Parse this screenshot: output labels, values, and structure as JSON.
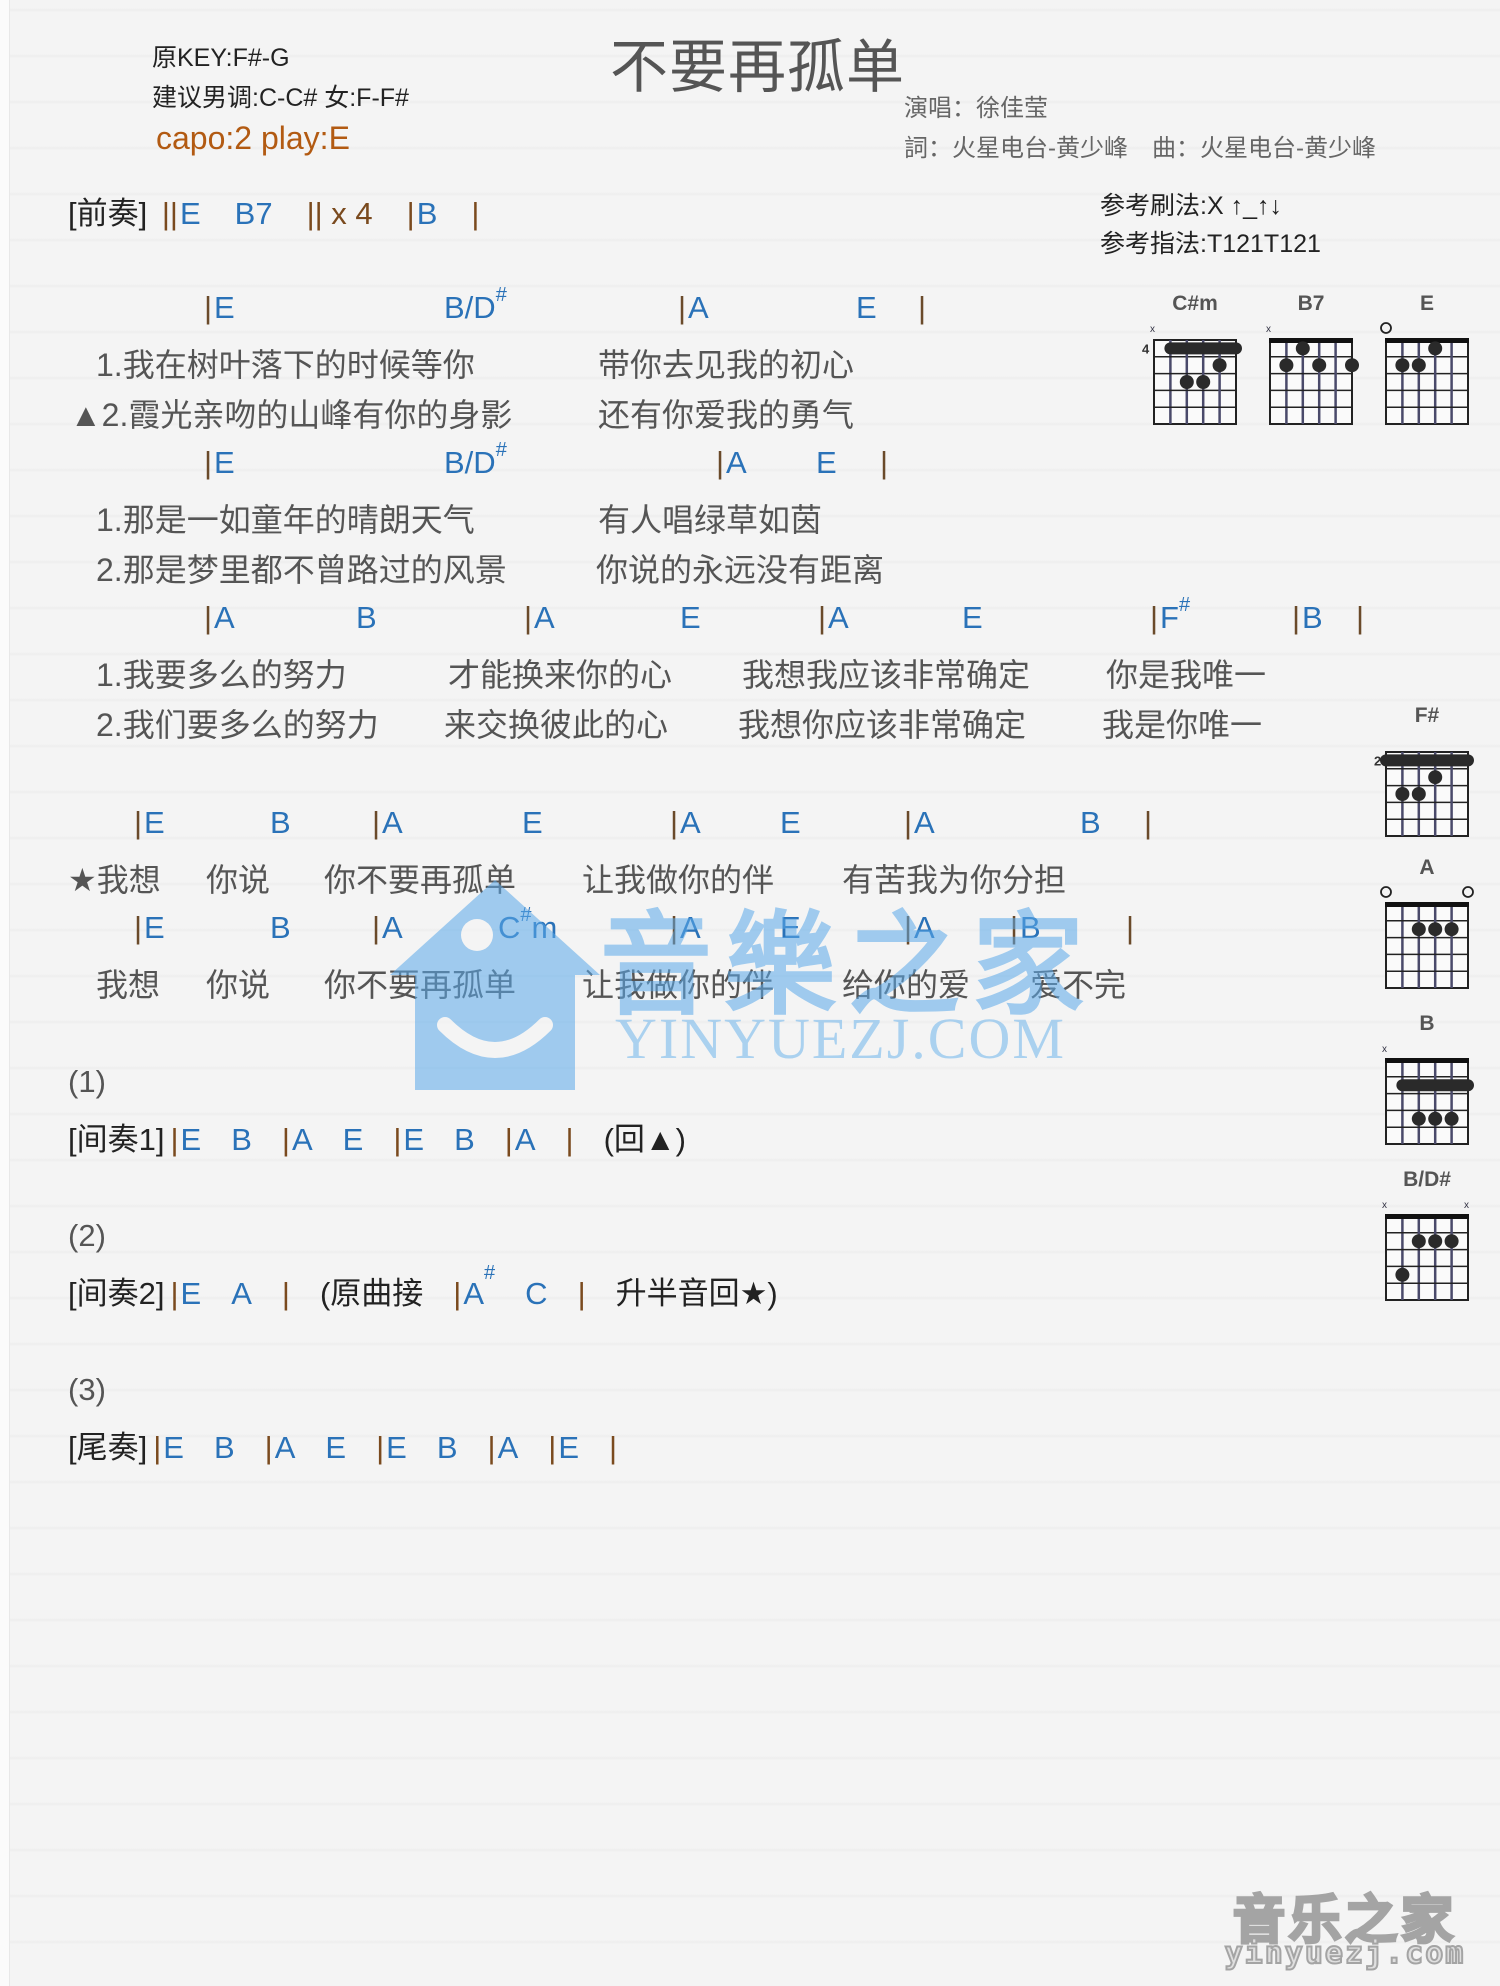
{
  "header": {
    "original_key": "原KEY:F#-G",
    "suggested_key": "建议男调:C-C# 女:F-F#",
    "capo": "capo:2 play:E",
    "title": "不要再孤单",
    "singer": "演唱：徐佳莹",
    "credits": "詞：火星电台-黄少峰　曲：火星电台-黄少峰",
    "strum_pattern": "参考刷法:X ↑_↑↓",
    "finger_pattern": "参考指法:T121T121"
  },
  "prelude": {
    "label": "[前奏]",
    "tokens": [
      {
        "t": "||",
        "k": "bar"
      },
      {
        "t": "E",
        "k": "chord"
      },
      {
        "t": "B7",
        "k": "chord"
      },
      {
        "t": "|| x 4",
        "k": "bar"
      },
      {
        "t": "|",
        "k": "bar"
      },
      {
        "t": "B",
        "k": "chord"
      },
      {
        "t": "|",
        "k": "bar"
      }
    ]
  },
  "verse_blocks": [
    {
      "chords": [
        {
          "bar": true,
          "name": "E"
        },
        {
          "bar": false,
          "name": "B/D",
          "sup": "#"
        },
        {
          "bar": true,
          "name": "A"
        },
        {
          "bar": false,
          "name": "E"
        },
        {
          "bar": true,
          "name": ""
        }
      ],
      "lyrics": [
        [
          "1.我在树叶落下的时候等你",
          "带你去见我的初心"
        ],
        [
          "▲2.霞光亲吻的山峰有你的身影",
          "还有你爱我的勇气"
        ]
      ]
    },
    {
      "chords": [
        {
          "bar": true,
          "name": "E"
        },
        {
          "bar": false,
          "name": "B/D",
          "sup": "#"
        },
        {
          "bar": true,
          "name": "A"
        },
        {
          "bar": false,
          "name": "E"
        },
        {
          "bar": true,
          "name": ""
        }
      ],
      "lyrics": [
        [
          "1.那是一如童年的晴朗天气",
          "有人唱绿草如茵"
        ],
        [
          "2.那是梦里都不曾路过的风景",
          "你说的永远没有距离"
        ]
      ]
    },
    {
      "chords": [
        {
          "bar": true,
          "name": "A"
        },
        {
          "bar": false,
          "name": "B"
        },
        {
          "bar": true,
          "name": "A"
        },
        {
          "bar": false,
          "name": "E"
        },
        {
          "bar": true,
          "name": "A"
        },
        {
          "bar": false,
          "name": "E"
        },
        {
          "bar": true,
          "name": "F",
          "sup": "#"
        },
        {
          "bar": true,
          "name": "B"
        },
        {
          "bar": true,
          "name": ""
        }
      ],
      "lyrics": [
        [
          "1.我要多么的努力",
          "才能换来你的心",
          "我想我应该非常确定",
          "你是我唯一"
        ],
        [
          "2.我们要多么的努力",
          "来交换彼此的心",
          "我想你应该非常确定",
          "我是你唯一"
        ]
      ]
    },
    {
      "chords": [
        {
          "bar": true,
          "name": "E"
        },
        {
          "bar": false,
          "name": "B"
        },
        {
          "bar": true,
          "name": "A"
        },
        {
          "bar": false,
          "name": "E"
        },
        {
          "bar": true,
          "name": "A"
        },
        {
          "bar": false,
          "name": "E"
        },
        {
          "bar": true,
          "name": "A"
        },
        {
          "bar": false,
          "name": "B"
        },
        {
          "bar": true,
          "name": ""
        }
      ],
      "lyrics": [
        [
          "★我想",
          "你说",
          "你不要再孤单",
          "让我做你的伴",
          "有苦我为你分担"
        ]
      ]
    },
    {
      "chords": [
        {
          "bar": true,
          "name": "E"
        },
        {
          "bar": false,
          "name": "B"
        },
        {
          "bar": true,
          "name": "A"
        },
        {
          "bar": false,
          "name": "C",
          "sup": "#",
          "suffix": "m"
        },
        {
          "bar": true,
          "name": "A"
        },
        {
          "bar": false,
          "name": "E"
        },
        {
          "bar": true,
          "name": "A"
        },
        {
          "bar": true,
          "name": "B"
        },
        {
          "bar": true,
          "name": ""
        }
      ],
      "lyrics": [
        [
          "我想",
          "你说",
          "你不要再孤单",
          "让我做你的伴",
          "给你的爱",
          "爱不完"
        ]
      ]
    }
  ],
  "interludes": [
    {
      "number": "(1)",
      "label": "[间奏1]",
      "tokens": [
        {
          "t": "|",
          "k": "bar"
        },
        {
          "t": "E",
          "k": "chord"
        },
        {
          "t": "B",
          "k": "chord"
        },
        {
          "t": "|",
          "k": "bar"
        },
        {
          "t": "A",
          "k": "chord"
        },
        {
          "t": "E",
          "k": "chord"
        },
        {
          "t": "|",
          "k": "bar"
        },
        {
          "t": "E",
          "k": "chord"
        },
        {
          "t": "B",
          "k": "chord"
        },
        {
          "t": "|",
          "k": "bar"
        },
        {
          "t": "A",
          "k": "chord"
        },
        {
          "t": "|",
          "k": "bar"
        },
        {
          "t": "(回▲)",
          "k": "text"
        }
      ]
    },
    {
      "number": "(2)",
      "label": "[间奏2]",
      "tokens": [
        {
          "t": "|",
          "k": "bar"
        },
        {
          "t": "E",
          "k": "chord"
        },
        {
          "t": "A",
          "k": "chord"
        },
        {
          "t": "|",
          "k": "bar"
        },
        {
          "t": "(原曲接",
          "k": "text"
        },
        {
          "t": "|",
          "k": "bar"
        },
        {
          "t": "A#",
          "k": "chord"
        },
        {
          "t": "C",
          "k": "chord"
        },
        {
          "t": "|",
          "k": "bar"
        },
        {
          "t": "升半音回★)",
          "k": "text"
        }
      ]
    },
    {
      "number": "(3)",
      "label": "[尾奏]",
      "tokens": [
        {
          "t": "|",
          "k": "bar"
        },
        {
          "t": "E",
          "k": "chord"
        },
        {
          "t": "B",
          "k": "chord"
        },
        {
          "t": "|",
          "k": "bar"
        },
        {
          "t": "A",
          "k": "chord"
        },
        {
          "t": "E",
          "k": "chord"
        },
        {
          "t": "|",
          "k": "bar"
        },
        {
          "t": "E",
          "k": "chord"
        },
        {
          "t": "B",
          "k": "chord"
        },
        {
          "t": "|",
          "k": "bar"
        },
        {
          "t": "A",
          "k": "chord"
        },
        {
          "t": "|",
          "k": "bar"
        },
        {
          "t": "E",
          "k": "chord"
        },
        {
          "t": "|",
          "k": "bar"
        }
      ]
    }
  ],
  "chord_diagrams": [
    {
      "name": "C#m",
      "base_fret": "4",
      "strings_top": [
        "x",
        "",
        "",
        "",
        "",
        ""
      ],
      "barre": {
        "fret": 1,
        "from": 5,
        "to": 1
      },
      "dots": [
        [
          2,
          2
        ],
        [
          3,
          4
        ],
        [
          3,
          3
        ]
      ]
    },
    {
      "name": "B7",
      "base_fret": "",
      "strings_top": [
        "x",
        "",
        "",
        "",
        "",
        ""
      ],
      "barre": null,
      "dots": [
        [
          1,
          4
        ],
        [
          2,
          5
        ],
        [
          2,
          3
        ],
        [
          2,
          1
        ]
      ]
    },
    {
      "name": "E",
      "base_fret": "",
      "strings_top": [
        "o",
        "",
        "",
        "",
        "",
        ""
      ],
      "barre": null,
      "dots": [
        [
          1,
          3
        ],
        [
          2,
          5
        ],
        [
          2,
          4
        ]
      ]
    },
    {
      "name": "F#",
      "base_fret": "2",
      "strings_top": [
        "",
        "",
        "",
        "",
        "",
        ""
      ],
      "barre": {
        "fret": 1,
        "from": 6,
        "to": 1
      },
      "dots": [
        [
          2,
          3
        ],
        [
          3,
          5
        ],
        [
          3,
          4
        ]
      ]
    },
    {
      "name": "A",
      "base_fret": "",
      "strings_top": [
        "o",
        "",
        "",
        "",
        "",
        "o"
      ],
      "barre": null,
      "dots": [
        [
          2,
          4
        ],
        [
          2,
          3
        ],
        [
          2,
          2
        ]
      ]
    },
    {
      "name": "B",
      "base_fret": "",
      "strings_top": [
        "x",
        "",
        "",
        "",
        "",
        ""
      ],
      "barre": {
        "fret": 2,
        "from": 5,
        "to": 1
      },
      "dots": [
        [
          4,
          4
        ],
        [
          4,
          3
        ],
        [
          4,
          2
        ]
      ]
    },
    {
      "name": "B/D#",
      "base_fret": "",
      "strings_top": [
        "x",
        "",
        "",
        "",
        "",
        "x"
      ],
      "barre": null,
      "dots": [
        [
          2,
          4
        ],
        [
          2,
          3
        ],
        [
          2,
          2
        ],
        [
          4,
          5
        ]
      ]
    }
  ],
  "watermark": {
    "cn": "音樂之家",
    "en": "YINYUEZJ.COM"
  },
  "logo": {
    "cn": "音乐之家",
    "en": "yinyuezj.com"
  }
}
